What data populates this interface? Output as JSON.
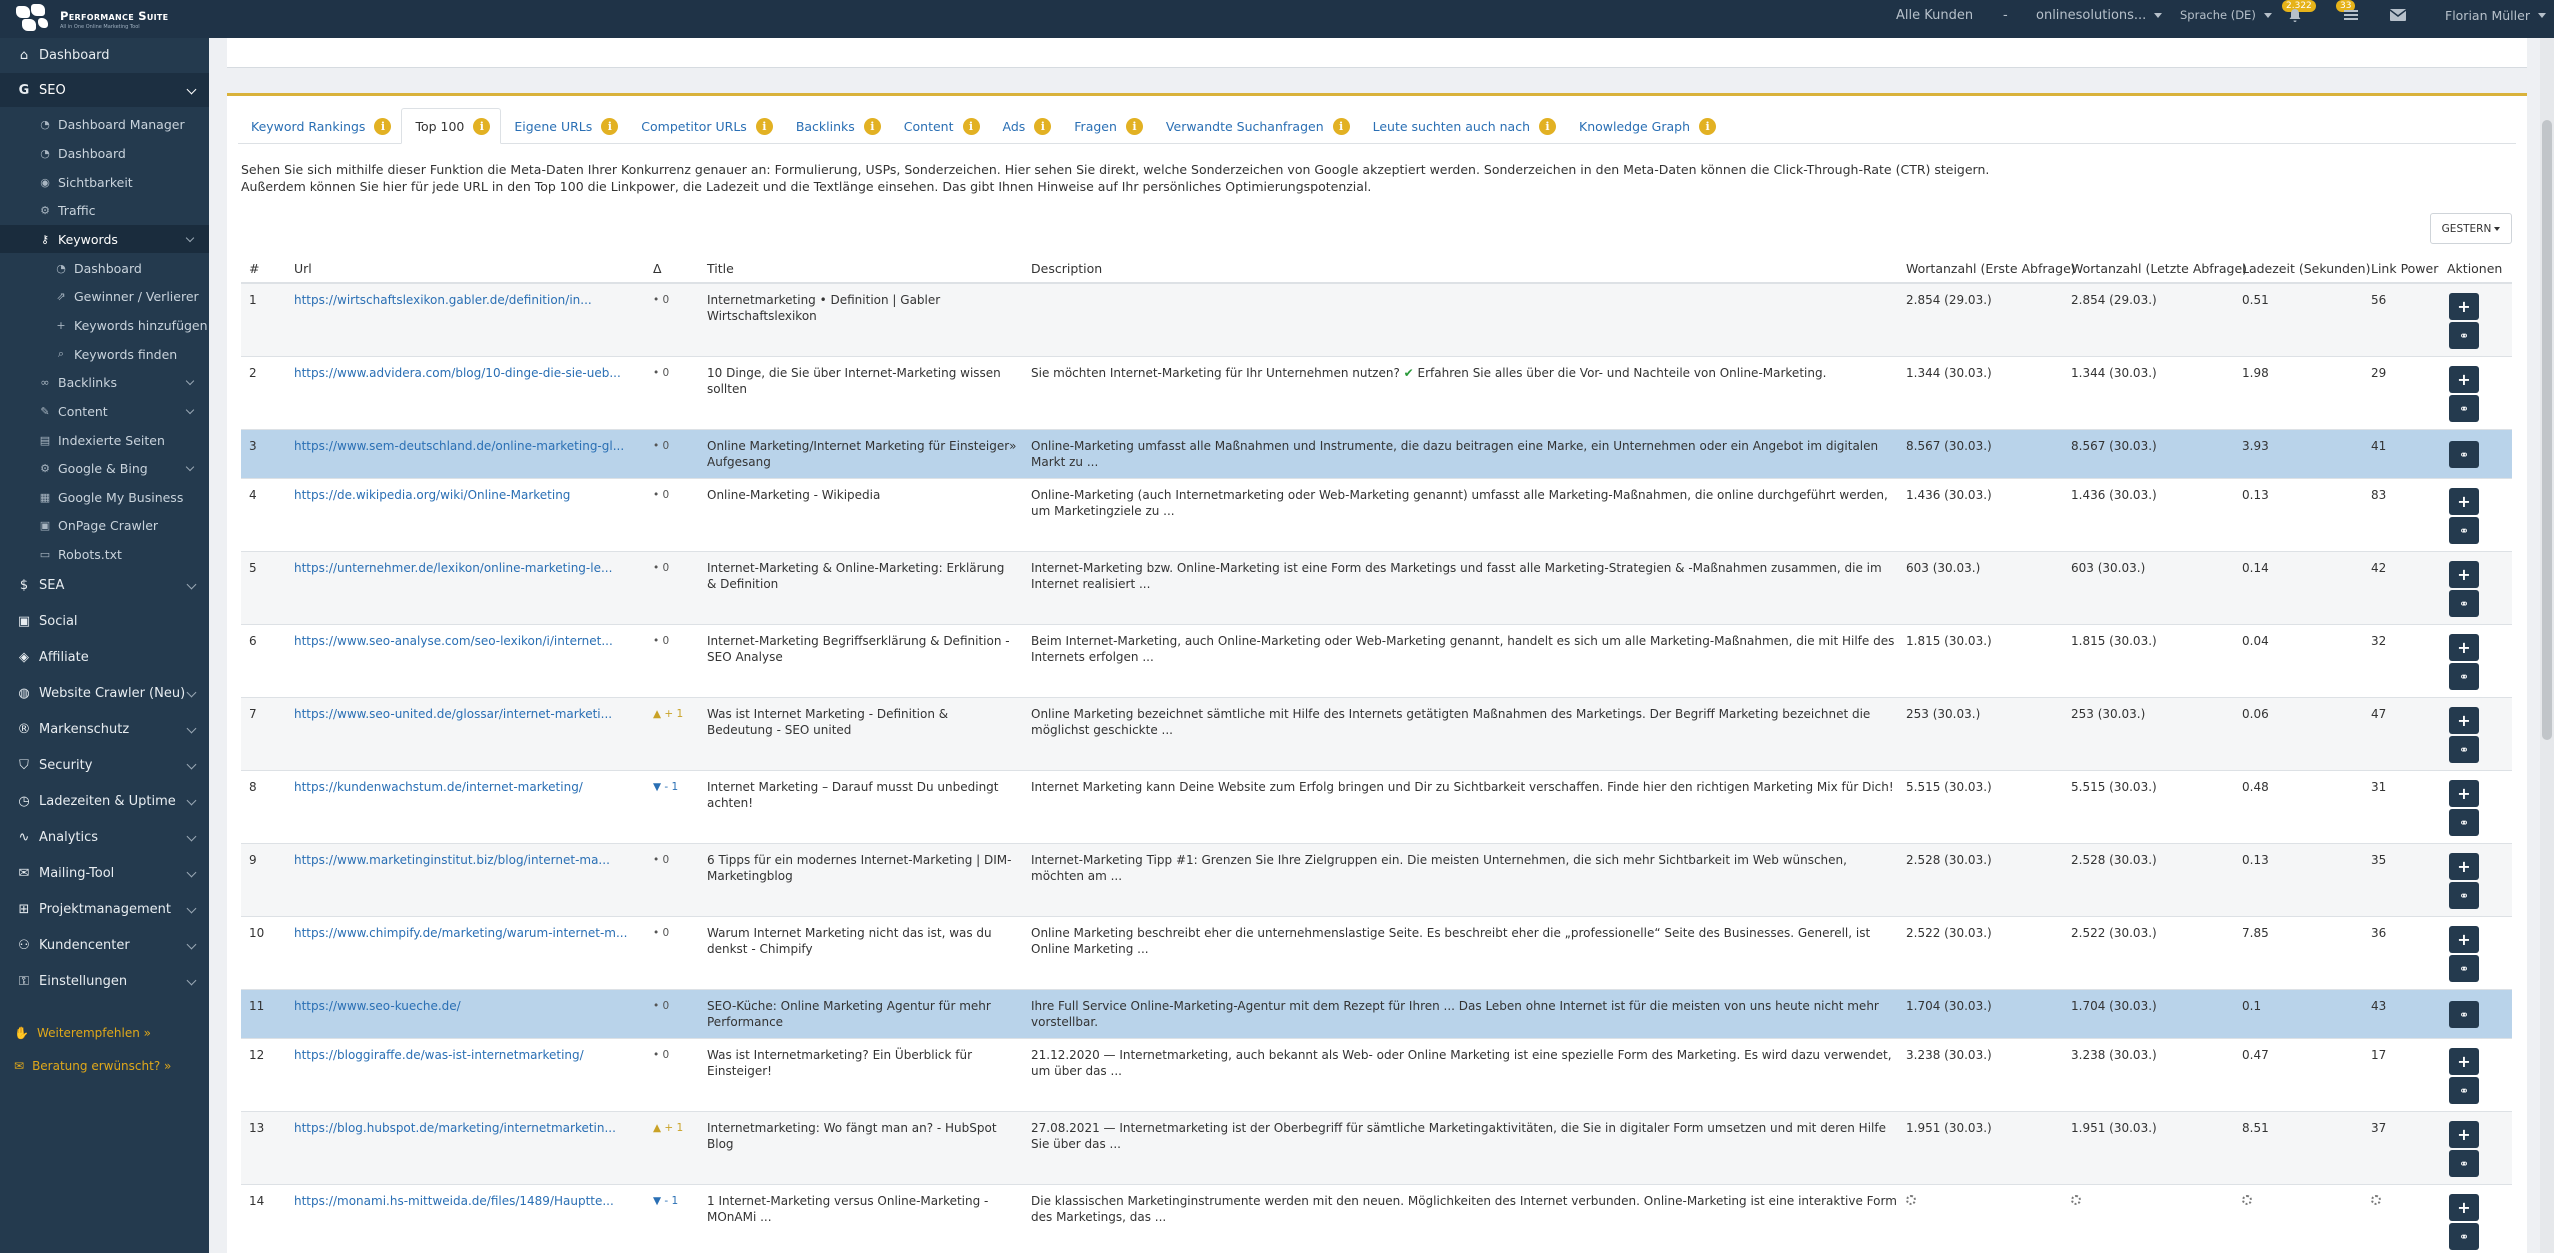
{
  "brand": {
    "name": "Performance Suite",
    "sub": "All in One Online Marketing Tool"
  },
  "topnav": {
    "customers": "Alle Kunden",
    "dash": "-",
    "account": "onlinesolutions...",
    "language": "Sprache (DE)",
    "badge1": "2.322",
    "badge2": "33",
    "user": "Florian Müller"
  },
  "sidebar": {
    "dashboard": "Dashboard",
    "seo": "SEO",
    "seo_items": [
      "Dashboard Manager",
      "Dashboard",
      "Sichtbarkeit",
      "Traffic"
    ],
    "keywords": "Keywords",
    "keyword_items": [
      "Dashboard",
      "Gewinner / Verlierer",
      "Keywords hinzufügen",
      "Keywords finden"
    ],
    "seo_more": [
      "Backlinks",
      "Content",
      "Indexierte Seiten",
      "Google & Bing",
      "Google My Business",
      "OnPage Crawler",
      "Robots.txt"
    ],
    "main_items": [
      "SEA",
      "Social",
      "Affiliate",
      "Website Crawler (Neu)",
      "Markenschutz",
      "Security",
      "Ladezeiten & Uptime",
      "Analytics",
      "Mailing-Tool",
      "Projektmanagement",
      "Kundencenter",
      "Einstellungen"
    ],
    "foot1": "Weiterempfehlen »",
    "foot2": "Beratung erwünscht? »"
  },
  "tabs": [
    "Keyword Rankings",
    "Top 100",
    "Eigene URLs",
    "Competitor URLs",
    "Backlinks",
    "Content",
    "Ads",
    "Fragen",
    "Verwandte Suchanfragen",
    "Leute suchten auch nach",
    "Knowledge Graph"
  ],
  "active_tab": "Top 100",
  "intro": {
    "line1": "Sehen Sie sich mithilfe dieser Funktion die Meta-Daten Ihrer Konkurrenz genauer an: Formulierung, USPs, Sonderzeichen. Hier sehen Sie direkt, welche Sonderzeichen von Google akzeptiert werden. Sonderzeichen in den Meta-Daten können die Click-Through-Rate (CTR) steigern.",
    "line2": "Außerdem können Sie hier für jede URL in den Top 100 die Linkpower, die Ladezeit und die Textlänge einsehen. Das gibt Ihnen Hinweise auf Ihr persönliches Optimierungspotenzial."
  },
  "date_button": "GESTERN",
  "table": {
    "headers": [
      "#",
      "Url",
      "Δ",
      "Title",
      "Description",
      "Wortanzahl (Erste Abfrage)",
      "Wortanzahl (Letzte Abfrage)",
      "Ladezeit (Sekunden)",
      "Link Power",
      "Aktionen"
    ],
    "rows": [
      {
        "n": "1",
        "url": "https://wirtschaftslexikon.gabler.de/definition/in...",
        "delta": "• 0",
        "dir": "zero",
        "title": "Internetmarketing • Definition | Gabler Wirtschaftslexikon",
        "desc": "",
        "w1": "2.854 (29.03.)",
        "w2": "2.854 (29.03.)",
        "load": "0.51",
        "lp": "56"
      },
      {
        "n": "2",
        "url": "https://www.advidera.com/blog/10-dinge-die-sie-ueb...",
        "delta": "• 0",
        "dir": "zero",
        "title": "10 Dinge, die Sie über Internet-Marketing wissen sollten",
        "desc": "Sie möchten Internet-Marketing für Ihr Unternehmen nutzen? ✔ Erfahren Sie alles über die Vor- und Nachteile von Online-Marketing.",
        "w1": "1.344 (30.03.)",
        "w2": "1.344 (30.03.)",
        "load": "1.98",
        "lp": "29"
      },
      {
        "n": "3",
        "url": "https://www.sem-deutschland.de/online-marketing-gl...",
        "delta": "• 0",
        "dir": "zero",
        "title": "Online Marketing/Internet Marketing für Einsteiger» Aufgesang",
        "desc": "Online-Marketing umfasst alle Maßnahmen und Instrumente, die dazu beitragen eine Marke, ein Unternehmen oder ein Angebot im digitalen Markt zu ...",
        "w1": "8.567 (30.03.)",
        "w2": "8.567 (30.03.)",
        "load": "3.93",
        "lp": "41"
      },
      {
        "n": "4",
        "url": "https://de.wikipedia.org/wiki/Online-Marketing",
        "delta": "• 0",
        "dir": "zero",
        "title": "Online-Marketing - Wikipedia",
        "desc": "Online-Marketing (auch Internetmarketing oder Web-Marketing genannt) umfasst alle Marketing-Maßnahmen, die online durchgeführt werden, um Marketingziele zu ...",
        "w1": "1.436 (30.03.)",
        "w2": "1.436 (30.03.)",
        "load": "0.13",
        "lp": "83"
      },
      {
        "n": "5",
        "url": "https://unternehmer.de/lexikon/online-marketing-le...",
        "delta": "• 0",
        "dir": "zero",
        "title": "Internet-Marketing & Online-Marketing: Erklärung & Definition",
        "desc": "Internet-Marketing bzw. Online-Marketing ist eine Form des Marketings und fasst alle Marketing-Strategien & -Maßnahmen zusammen, die im Internet realisiert ...",
        "w1": "603 (30.03.)",
        "w2": "603 (30.03.)",
        "load": "0.14",
        "lp": "42"
      },
      {
        "n": "6",
        "url": "https://www.seo-analyse.com/seo-lexikon/i/internet...",
        "delta": "• 0",
        "dir": "zero",
        "title": "Internet-Marketing Begriffserklärung & Definition - SEO Analyse",
        "desc": "Beim Internet-Marketing, auch Online-Marketing oder Web-Marketing genannt, handelt es sich um alle Marketing-Maßnahmen, die mit Hilfe des Internets erfolgen ...",
        "w1": "1.815 (30.03.)",
        "w2": "1.815 (30.03.)",
        "load": "0.04",
        "lp": "32"
      },
      {
        "n": "7",
        "url": "https://www.seo-united.de/glossar/internet-marketi...",
        "delta": "▲ + 1",
        "dir": "up",
        "title": "Was ist Internet Marketing - Definition & Bedeutung - SEO united",
        "desc": "Online Marketing bezeichnet sämtliche mit Hilfe des Internets getätigten Maßnahmen des Marketings. Der Begriff Marketing bezeichnet die möglichst geschickte ...",
        "w1": "253 (30.03.)",
        "w2": "253 (30.03.)",
        "load": "0.06",
        "lp": "47"
      },
      {
        "n": "8",
        "url": "https://kundenwachstum.de/internet-marketing/",
        "delta": "▼ - 1",
        "dir": "down",
        "title": "Internet Marketing – Darauf musst Du unbedingt achten!",
        "desc": "Internet Marketing kann Deine Website zum Erfolg bringen und Dir zu Sichtbarkeit verschaffen. Finde hier den richtigen Marketing Mix für Dich!",
        "w1": "5.515 (30.03.)",
        "w2": "5.515 (30.03.)",
        "load": "0.48",
        "lp": "31"
      },
      {
        "n": "9",
        "url": "https://www.marketinginstitut.biz/blog/internet-ma...",
        "delta": "• 0",
        "dir": "zero",
        "title": "6 Tipps für ein modernes Internet-Marketing | DIM-Marketingblog",
        "desc": "Internet-Marketing Tipp #1: Grenzen Sie Ihre Zielgruppen ein. Die meisten Unternehmen, die sich mehr Sichtbarkeit im Web wünschen, möchten am ...",
        "w1": "2.528 (30.03.)",
        "w2": "2.528 (30.03.)",
        "load": "0.13",
        "lp": "35"
      },
      {
        "n": "10",
        "url": "https://www.chimpify.de/marketing/warum-internet-m...",
        "delta": "• 0",
        "dir": "zero",
        "title": "Warum Internet Marketing nicht das ist, was du denkst - Chimpify",
        "desc": "Online Marketing beschreibt eher die unternehmenslastige Seite. Es beschreibt eher die „professionelle“ Seite des Businesses. Generell, ist Online Marketing ...",
        "w1": "2.522 (30.03.)",
        "w2": "2.522 (30.03.)",
        "load": "7.85",
        "lp": "36"
      },
      {
        "n": "11",
        "url": "https://www.seo-kueche.de/",
        "delta": "• 0",
        "dir": "zero",
        "title": "SEO-Küche: Online Marketing Agentur für mehr Performance",
        "desc": "Ihre Full Service Online-Marketing-Agentur mit dem Rezept für Ihren ... Das Leben ohne Internet ist für die meisten von uns heute nicht mehr vorstellbar.",
        "w1": "1.704 (30.03.)",
        "w2": "1.704 (30.03.)",
        "load": "0.1",
        "lp": "43"
      },
      {
        "n": "12",
        "url": "https://bloggiraffe.de/was-ist-internetmarketing/",
        "delta": "• 0",
        "dir": "zero",
        "title": "Was ist Internetmarketing? Ein Überblick für Einsteiger!",
        "desc": "21.12.2020 — Internetmarketing, auch bekannt als Web- oder Online Marketing ist eine spezielle Form des Marketing. Es wird dazu verwendet, um über das ...",
        "w1": "3.238 (30.03.)",
        "w2": "3.238 (30.03.)",
        "load": "0.47",
        "lp": "17"
      },
      {
        "n": "13",
        "url": "https://blog.hubspot.de/marketing/internetmarketin...",
        "delta": "▲ + 1",
        "dir": "up",
        "title": "Internetmarketing: Wo fängt man an? - HubSpot Blog",
        "desc": "27.08.2021 — Internetmarketing ist der Oberbegriff für sämtliche Marketingaktivitäten, die Sie in digitaler Form umsetzen und mit deren Hilfe Sie über das ...",
        "w1": "1.951 (30.03.)",
        "w2": "1.951 (30.03.)",
        "load": "8.51",
        "lp": "37"
      },
      {
        "n": "14",
        "url": "https://monami.hs-mittweida.de/files/1489/Hauptte...",
        "delta": "▼ - 1",
        "dir": "down",
        "title": "1 Internet-Marketing versus Online-Marketing - MOnAMi ...",
        "desc": "Die klassischen Marketinginstrumente werden mit den neuen. Möglichkeiten des Internet verbunden. Online-Marketing ist eine interaktive Form des Marketings, das ...",
        "w1": "",
        "w2": "",
        "load": "",
        "lp": ""
      }
    ]
  }
}
